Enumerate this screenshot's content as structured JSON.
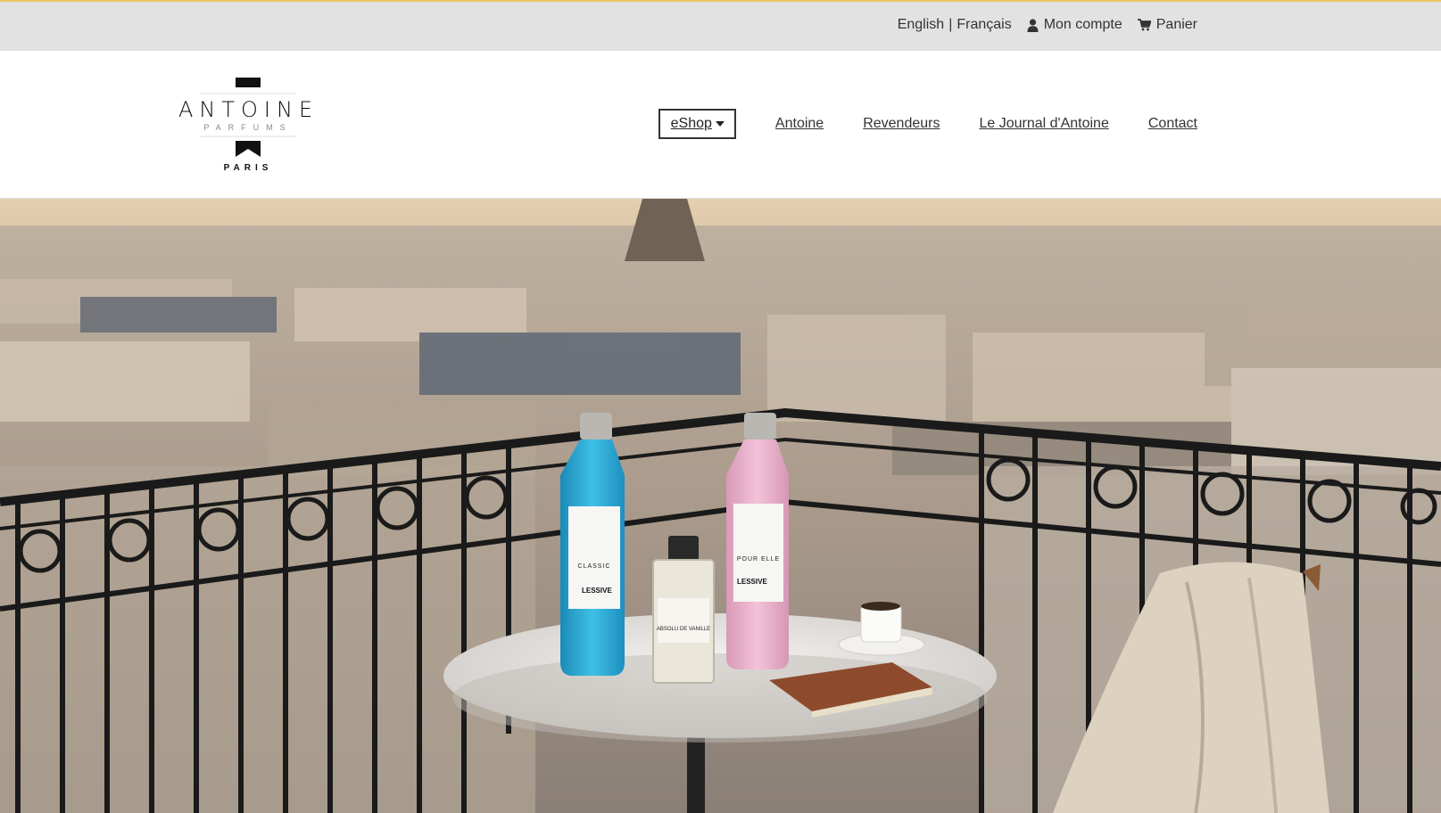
{
  "topbar": {
    "lang_en": "English",
    "lang_sep": "|",
    "lang_fr": "Français",
    "account": "Mon compte",
    "cart": "Panier"
  },
  "logo": {
    "wordmark": "ANTOINE",
    "sub": "PARFUMS",
    "city": "PARIS"
  },
  "nav": {
    "eshop": "eShop",
    "items": [
      "Antoine",
      "Revendeurs",
      "Le Journal d'Antoine",
      "Contact"
    ]
  },
  "hero": {
    "bottle_blue_label": "CLASSIC",
    "bottle_pink_label": "POUR ELLE",
    "bottle_small_label": "ABSOLU DE VANILLE",
    "product_type": "LESSIVE"
  },
  "colors": {
    "accent_top": "#e8c860",
    "topbar_bg": "#e2e2e2"
  },
  "icons": {
    "account": "user-icon",
    "cart": "cart-icon",
    "dropdown": "caret-down-icon"
  }
}
